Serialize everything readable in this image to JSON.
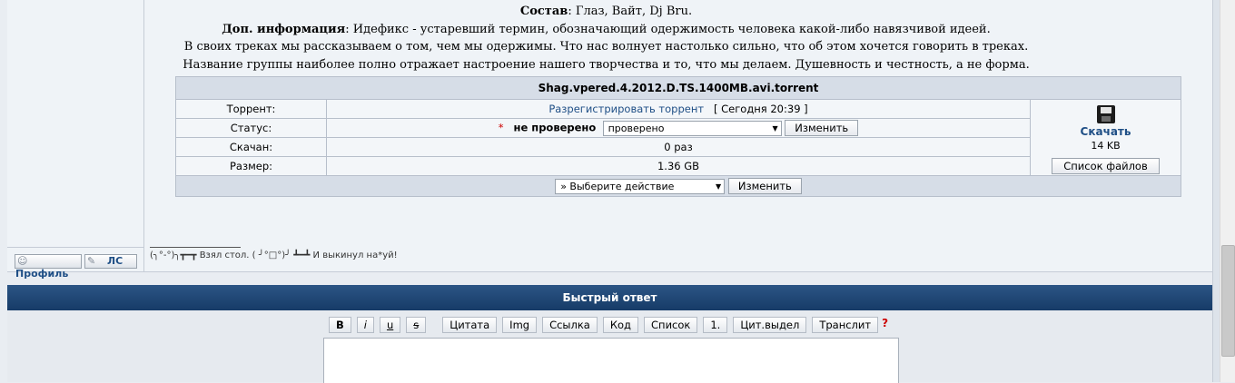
{
  "description": {
    "sostav_label": "Состав",
    "sostav_value": ": Глаз, Вайт, Dj Bru.",
    "info_label": "Доп. информация",
    "info_value": ": Идефикс - устаревший термин, обозначающий одержимость человека какой-либо навязчивой идеей.",
    "line3": "В своих треках мы рассказываем о том, чем мы одержимы. Что нас волнует настолько сильно, что об этом хочется говорить в треках.",
    "line4": "Название группы наиболее полно отражает настроение нашего творчества и то, что мы делаем. Душевность и честность, а не форма."
  },
  "torrent": {
    "filename": "Shag.vpered.4.2012.D.TS.1400MB.avi.torrent",
    "torrent_label": "Торрент:",
    "unregister_link": "Разрегистрировать торрент",
    "date": "[ Сегодня 20:39 ]",
    "status_label": "Статус:",
    "status_star": "*",
    "status_value": "не проверено",
    "status_select": "проверено",
    "change_button": "Изменить",
    "downloaded_label": "Скачан:",
    "downloaded_value": "0 раз",
    "size_label": "Размер:",
    "size_value": "1.36 GB",
    "download_link": "Скачать",
    "download_size": "14 KB",
    "file_list_button": "Список файлов",
    "action_select": "» Выберите действие",
    "action_change_button": "Изменить"
  },
  "post_buttons": {
    "profile": "Профиль",
    "pm": "ЛС"
  },
  "signature": "(╮°-°)╮┳━┳ Взял стол. ( ╯°□°)╯ ┻━┻ И выкинул на*уй!",
  "quick_reply": {
    "title": "Быстрый ответ",
    "toolbar": {
      "bold": "B",
      "italic": "i",
      "underline": "u",
      "strike": "s",
      "quote": "Цитата",
      "img": "Img",
      "link": "Ссылка",
      "code": "Код",
      "list": "Список",
      "list_item": "1.",
      "quote_selected": "Цит.выдел",
      "translit": "Транслит",
      "help": "?"
    }
  },
  "colors": {
    "header_bg": "#1f4775",
    "link": "#1f4f86",
    "accent_red": "#cc0000"
  }
}
